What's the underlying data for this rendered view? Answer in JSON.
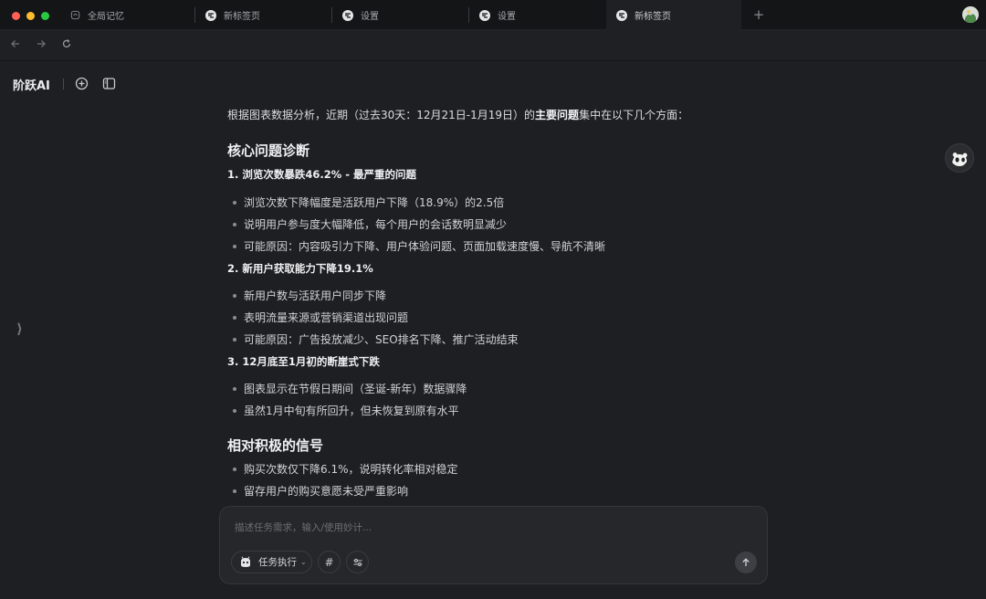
{
  "browser": {
    "tabs": [
      {
        "label": "全局记忆",
        "icon": "memory-icon",
        "active": false
      },
      {
        "label": "新标签页",
        "icon": "brand-logo-icon",
        "active": false
      },
      {
        "label": "设置",
        "icon": "brand-logo-icon",
        "active": false
      },
      {
        "label": "设置",
        "icon": "brand-logo-icon",
        "active": false
      },
      {
        "label": "新标签页",
        "icon": "brand-logo-icon",
        "active": true
      }
    ],
    "new_tab_glyph": "+"
  },
  "app": {
    "logo": "阶跃AI"
  },
  "sidebar": {
    "toggle_glyph": "⟩"
  },
  "message": {
    "intro_pre": "根据图表数据分析，近期（过去30天：12月21日-1月19日）的",
    "intro_bold": "主要问题",
    "intro_post": "集中在以下几个方面：",
    "sections": [
      {
        "heading": "核心问题诊断",
        "items": [
          {
            "title": "1. 浏览次数暴跌46.2% - 最严重的问题",
            "bullets": [
              "浏览次数下降幅度是活跃用户下降（18.9%）的2.5倍",
              "说明用户参与度大幅降低，每个用户的会话数明显减少",
              "可能原因：内容吸引力下降、用户体验问题、页面加载速度慢、导航不清晰"
            ]
          },
          {
            "title": "2. 新用户获取能力下降19.1%",
            "bullets": [
              "新用户数与活跃用户同步下降",
              "表明流量来源或营销渠道出现问题",
              "可能原因：广告投放减少、SEO排名下降、推广活动结束"
            ]
          },
          {
            "title": "3. 12月底至1月初的断崖式下跌",
            "bullets": [
              "图表显示在节假日期间（圣诞-新年）数据骤降",
              "虽然1月中旬有所回升，但未恢复到原有水平"
            ]
          }
        ]
      },
      {
        "heading": "相对积极的信号",
        "bullets": [
          "购买次数仅下降6.1%，说明转化率相对稳定",
          "留存用户的购买意愿未受严重影响"
        ]
      }
    ]
  },
  "composer": {
    "placeholder": "描述任务需求，输入/使用妙计...",
    "value": "",
    "mode_label": "任务执行",
    "hash_glyph": "#"
  }
}
